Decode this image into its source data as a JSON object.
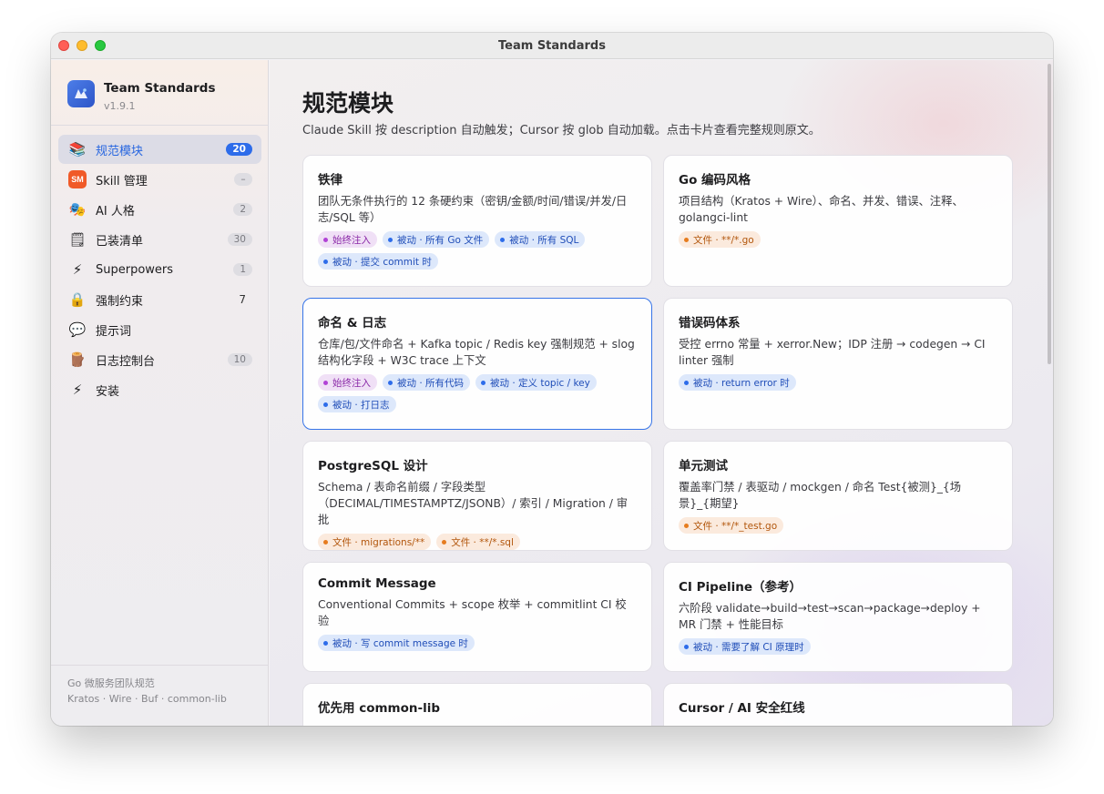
{
  "window": {
    "title": "Team Standards"
  },
  "app": {
    "name": "Team Standards",
    "version": "v1.9.1",
    "icon": "app-logo-icon"
  },
  "sidebar": {
    "items": [
      {
        "label": "规范模块",
        "icon": "books-icon",
        "glyph": "📚",
        "badge": "20",
        "badge_style": "blue",
        "active": true
      },
      {
        "label": "Skill 管理",
        "icon": "sm-icon",
        "glyph": "SM",
        "badge": "–",
        "badge_style": "gray"
      },
      {
        "label": "AI 人格",
        "icon": "persona-icon",
        "glyph": "🎭",
        "badge": "2",
        "badge_style": "gray"
      },
      {
        "label": "已装清单",
        "icon": "clipboard-icon",
        "glyph": "🗒",
        "badge": "30",
        "badge_style": "gray"
      },
      {
        "label": "Superpowers",
        "icon": "lightning-icon",
        "glyph": "⚡",
        "badge": "1",
        "badge_style": "gray"
      },
      {
        "label": "强制约束",
        "icon": "lock-icon",
        "glyph": "🔒",
        "badge": "7",
        "badge_style": "plain"
      },
      {
        "label": "提示词",
        "icon": "speech-bubble-icon",
        "glyph": "💬",
        "badge": "",
        "badge_style": "none"
      },
      {
        "label": "日志控制台",
        "icon": "log-icon",
        "glyph": "🪵",
        "badge": "10",
        "badge_style": "gray"
      },
      {
        "label": "安装",
        "icon": "lightning-icon",
        "glyph": "⚡",
        "badge": "",
        "badge_style": "none"
      }
    ],
    "footer_line1": "Go 微服务团队规范",
    "footer_line2": "Kratos · Wire · Buf · common-lib"
  },
  "main": {
    "title": "规范模块",
    "subtitle": "Claude Skill 按 description 自动触发；Cursor 按 glob 自动加载。点击卡片查看完整规则原文。",
    "cards": [
      {
        "title": "铁律",
        "desc": "团队无条件执行的 12 条硬约束（密钥/金额/时间/错误/并发/日志/SQL 等）",
        "tags": [
          {
            "kind": "always",
            "text": "始终注入"
          },
          {
            "kind": "passive",
            "text": "被动 · 所有 Go 文件"
          },
          {
            "kind": "passive",
            "text": "被动 · 所有 SQL"
          },
          {
            "kind": "passive",
            "text": "被动 · 提交 commit 时"
          }
        ]
      },
      {
        "title": "Go 编码风格",
        "desc": "项目结构（Kratos + Wire）、命名、并发、错误、注释、golangci-lint",
        "tags": [
          {
            "kind": "file",
            "text": "文件 · **/*.go"
          }
        ]
      },
      {
        "title": "命名 & 日志",
        "desc": "仓库/包/文件命名 + Kafka topic / Redis key 强制规范 + slog 结构化字段 + W3C trace 上下文",
        "selected": true,
        "tags": [
          {
            "kind": "always",
            "text": "始终注入"
          },
          {
            "kind": "passive",
            "text": "被动 · 所有代码"
          },
          {
            "kind": "passive",
            "text": "被动 · 定义 topic / key"
          },
          {
            "kind": "passive",
            "text": "被动 · 打日志"
          }
        ]
      },
      {
        "title": "错误码体系",
        "desc": "受控 errno 常量 + xerror.New；IDP 注册 → codegen → CI linter 强制",
        "tags": [
          {
            "kind": "passive",
            "text": "被动 · return error 时"
          }
        ]
      },
      {
        "title": "PostgreSQL 设计",
        "desc": "Schema / 表命名前缀 / 字段类型（DECIMAL/TIMESTAMPTZ/JSONB）/ 索引 / Migration / 审批",
        "tags": [
          {
            "kind": "file",
            "text": "文件 · migrations/**"
          },
          {
            "kind": "file",
            "text": "文件 · **/*.sql"
          }
        ]
      },
      {
        "title": "单元测试",
        "desc": "覆盖率门禁 / 表驱动 / mockgen / 命名 Test{被测}_{场景}_{期望}",
        "tags": [
          {
            "kind": "file",
            "text": "文件 · **/*_test.go"
          }
        ]
      },
      {
        "title": "Commit Message",
        "desc": "Conventional Commits + scope 枚举 + commitlint CI 校验",
        "tags": [
          {
            "kind": "passive",
            "text": "被动 · 写 commit message 时"
          }
        ]
      },
      {
        "title": "CI Pipeline（参考）",
        "desc": "六阶段 validate→build→test→scan→package→deploy + MR 门禁 + 性能目标",
        "tags": [
          {
            "kind": "passive",
            "text": "被动 · 需要了解 CI 原理时"
          }
        ]
      },
      {
        "title": "优先用 common-lib",
        "desc": "",
        "tags": []
      },
      {
        "title": "Cursor / AI 安全红线",
        "desc": "",
        "tags": []
      }
    ]
  }
}
